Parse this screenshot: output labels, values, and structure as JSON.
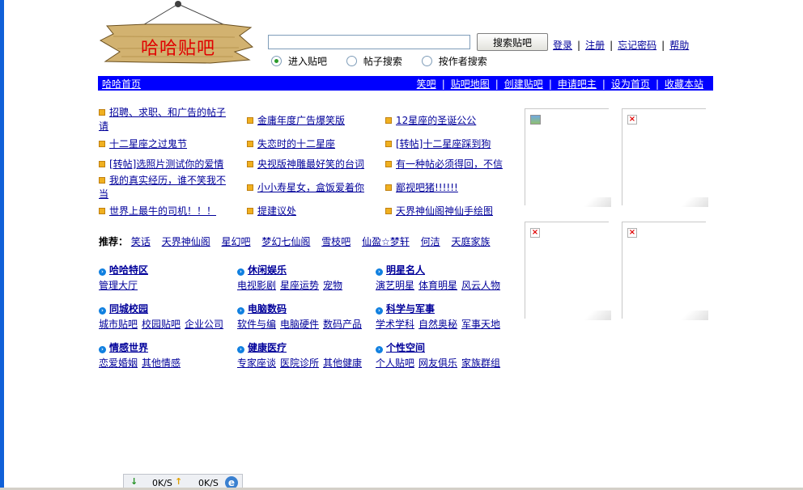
{
  "logo": {
    "text": "哈哈贴吧"
  },
  "search": {
    "button_label": "搜索贴吧",
    "input_value": "",
    "options": [
      {
        "label": "进入贴吧",
        "selected": true
      },
      {
        "label": "帖子搜索",
        "selected": false
      },
      {
        "label": "按作者搜索",
        "selected": false
      }
    ]
  },
  "toplinks": [
    "登录",
    "注册",
    "忘记密码",
    "帮助"
  ],
  "nav": {
    "home": "哈哈首页",
    "links": [
      "笑吧",
      "贴吧地图",
      "创建贴吧",
      "申请吧主",
      "设为首页",
      "收藏本站"
    ]
  },
  "notices": {
    "col1": [
      "招聘、求职、和广告的帖子请",
      "十二星座之过鬼节",
      "[转帖]选照片测试你的爱情",
      "我的真实经历，谁不笑我不当",
      "世界上最牛的司机！！！"
    ],
    "col2": [
      "金庸年度广告爆笑版",
      "失恋时的十二星座",
      "央视版神雕最好笑的台词",
      "小小寿星女，盒饭爱着你",
      "提建议处"
    ],
    "col3": [
      "12星座的圣诞公公",
      "[转帖]十二星座踩到狗",
      "有一种帖必须得回，不信",
      "鄙视吧猪!!!!!!",
      "天界神仙阁神仙手绘图"
    ]
  },
  "recommend": {
    "label": "推荐：",
    "items": [
      "笑话",
      "天界神仙阁",
      "星幻吧",
      "梦幻七仙阁",
      "雪枝吧",
      "仙盈☆梦轩",
      "何洁",
      "天庭家族"
    ]
  },
  "categories": [
    {
      "title": "哈哈特区",
      "subs": [
        "管理大厅"
      ]
    },
    {
      "title": "休闲娱乐",
      "subs": [
        "电视影剧",
        "星座运势",
        "宠物"
      ]
    },
    {
      "title": "明星名人",
      "subs": [
        "演艺明星",
        "体育明星",
        "风云人物"
      ]
    },
    {
      "title": "同城校园",
      "subs": [
        "城市贴吧",
        "校园贴吧",
        "企业公司"
      ]
    },
    {
      "title": "电脑数码",
      "subs": [
        "软件与编",
        "电脑硬件",
        "数码产品"
      ]
    },
    {
      "title": "科学与军事",
      "subs": [
        "学术学科",
        "自然奥秘",
        "军事天地"
      ]
    },
    {
      "title": "情感世界",
      "subs": [
        "恋爱婚姻",
        "其他情感"
      ]
    },
    {
      "title": "健康医疗",
      "subs": [
        "专家座谈",
        "医院诊所",
        "其他健康"
      ]
    },
    {
      "title": "个性空间",
      "subs": [
        "个人贴吧",
        "网友俱乐",
        "家族群组"
      ]
    }
  ],
  "status": {
    "down": "0K/S",
    "up": "0K/S"
  },
  "colors": {
    "nav_bg": "#0000ff",
    "link": "#00009a",
    "logo_text": "#e00000",
    "logo_board": "#d2b270"
  }
}
